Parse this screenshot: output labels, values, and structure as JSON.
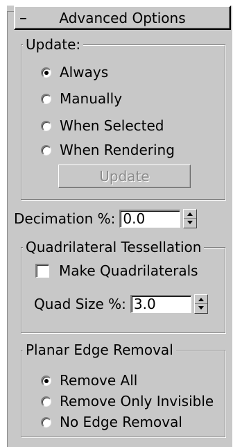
{
  "rollout": {
    "collapse_symbol": "–",
    "title": "Advanced Options"
  },
  "update_group": {
    "legend": "Update:",
    "options": [
      "Always",
      "Manually",
      "When Selected",
      "When Rendering"
    ],
    "selected": "Always",
    "button_label": "Update"
  },
  "decimation": {
    "label": "Decimation %:",
    "value": "0.0"
  },
  "quad_group": {
    "legend": "Quadrilateral Tessellation",
    "checkbox_label": "Make Quadrilaterals",
    "checkbox_checked": false,
    "quad_size_label": "Quad Size %:",
    "quad_size_value": "3.0"
  },
  "planar_group": {
    "legend": "Planar Edge Removal",
    "options": [
      "Remove All",
      "Remove Only Invisible",
      "No Edge Removal"
    ],
    "selected": "Remove All"
  }
}
